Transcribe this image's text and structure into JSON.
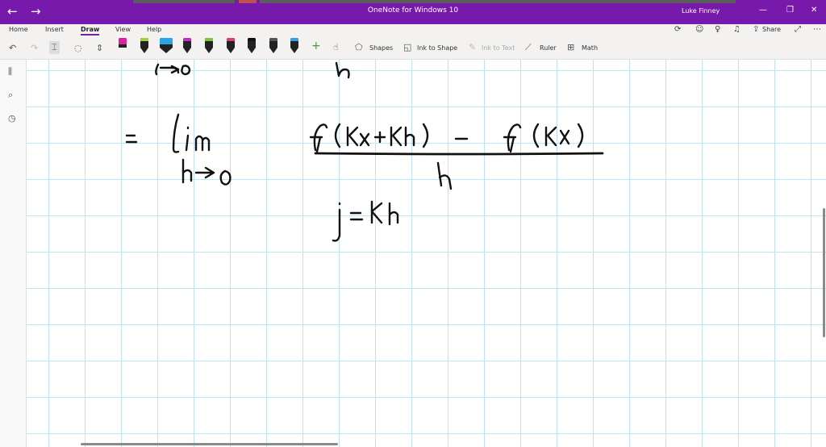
{
  "window": {
    "title": "OneNote for Windows 10",
    "user": "Luke Finney",
    "back_glyph": "←",
    "forward_glyph": "→",
    "minimize_glyph": "—",
    "restore_glyph": "❐",
    "close_glyph": "✕"
  },
  "ribbon": {
    "tabs": [
      "Home",
      "Insert",
      "Draw",
      "View",
      "Help"
    ],
    "active_tab": "Draw",
    "share_label": "Share"
  },
  "toolbar": {
    "shapes_label": "Shapes",
    "ink_to_shape_label": "Ink to Shape",
    "ink_to_text_label": "Ink to Text",
    "ruler_label": "Ruler",
    "math_label": "Math",
    "add_glyph": "+"
  },
  "pens": [
    {
      "color": "#e020a0",
      "highlighter": true
    },
    {
      "color": "#9ed33a"
    },
    {
      "color": "#2aa6e8",
      "highlighter": true
    },
    {
      "color": "#c22fc5"
    },
    {
      "color": "#7cc63a"
    },
    {
      "color": "#e23b6d"
    },
    {
      "color": "#111111"
    },
    {
      "color": "#555555"
    },
    {
      "color": "#2aa6e8"
    }
  ],
  "accent_color": "#7719aa"
}
